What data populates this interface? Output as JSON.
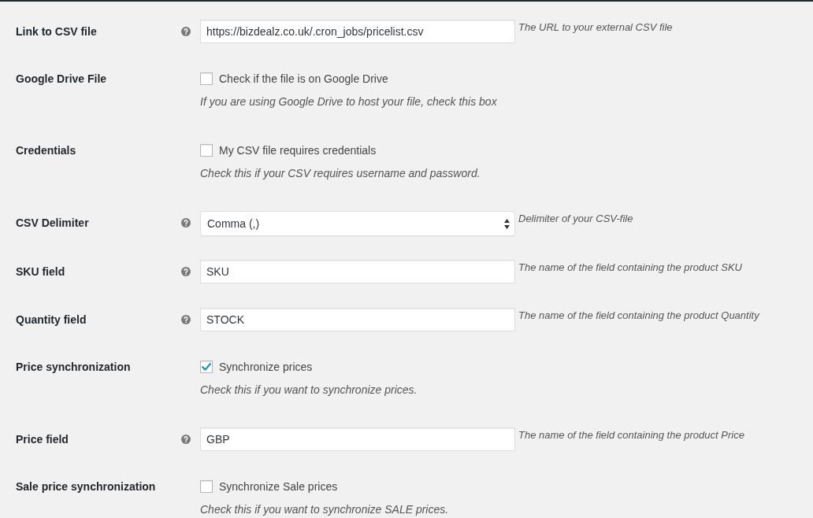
{
  "settings": [
    {
      "kind": "text",
      "label": "Link to CSV file",
      "value": "https://bizdealz.co.uk/.cron_jobs/pricelist.csv",
      "description": "The URL to your external CSV file"
    },
    {
      "kind": "checkbox",
      "label": "Google Drive File",
      "option": "Check if the file is on Google Drive",
      "checked": false,
      "description": "If you are using Google Drive to host your file, check this box"
    },
    {
      "kind": "checkbox",
      "label": "Credentials",
      "option": "My CSV file requires credentials",
      "checked": false,
      "description": "Check this if your CSV requires username and password."
    },
    {
      "kind": "select",
      "label": "CSV Delimiter",
      "value": "Comma (,)",
      "description": "Delimiter of your CSV-file"
    },
    {
      "kind": "text",
      "label": "SKU field",
      "value": "SKU",
      "description": "The name of the field containing the product SKU"
    },
    {
      "kind": "text",
      "label": "Quantity field",
      "value": "STOCK",
      "description": "The name of the field containing the product Quantity"
    },
    {
      "kind": "checkbox",
      "label": "Price synchronization",
      "option": "Synchronize prices",
      "checked": true,
      "description": "Check this if you want to synchronize prices."
    },
    {
      "kind": "text",
      "label": "Price field",
      "value": "GBP",
      "description": "The name of the field containing the product Price"
    },
    {
      "kind": "checkbox",
      "label": "Sale price synchronization",
      "option": "Synchronize Sale prices",
      "checked": false,
      "description": "Check this if you want to synchronize SALE prices."
    }
  ]
}
